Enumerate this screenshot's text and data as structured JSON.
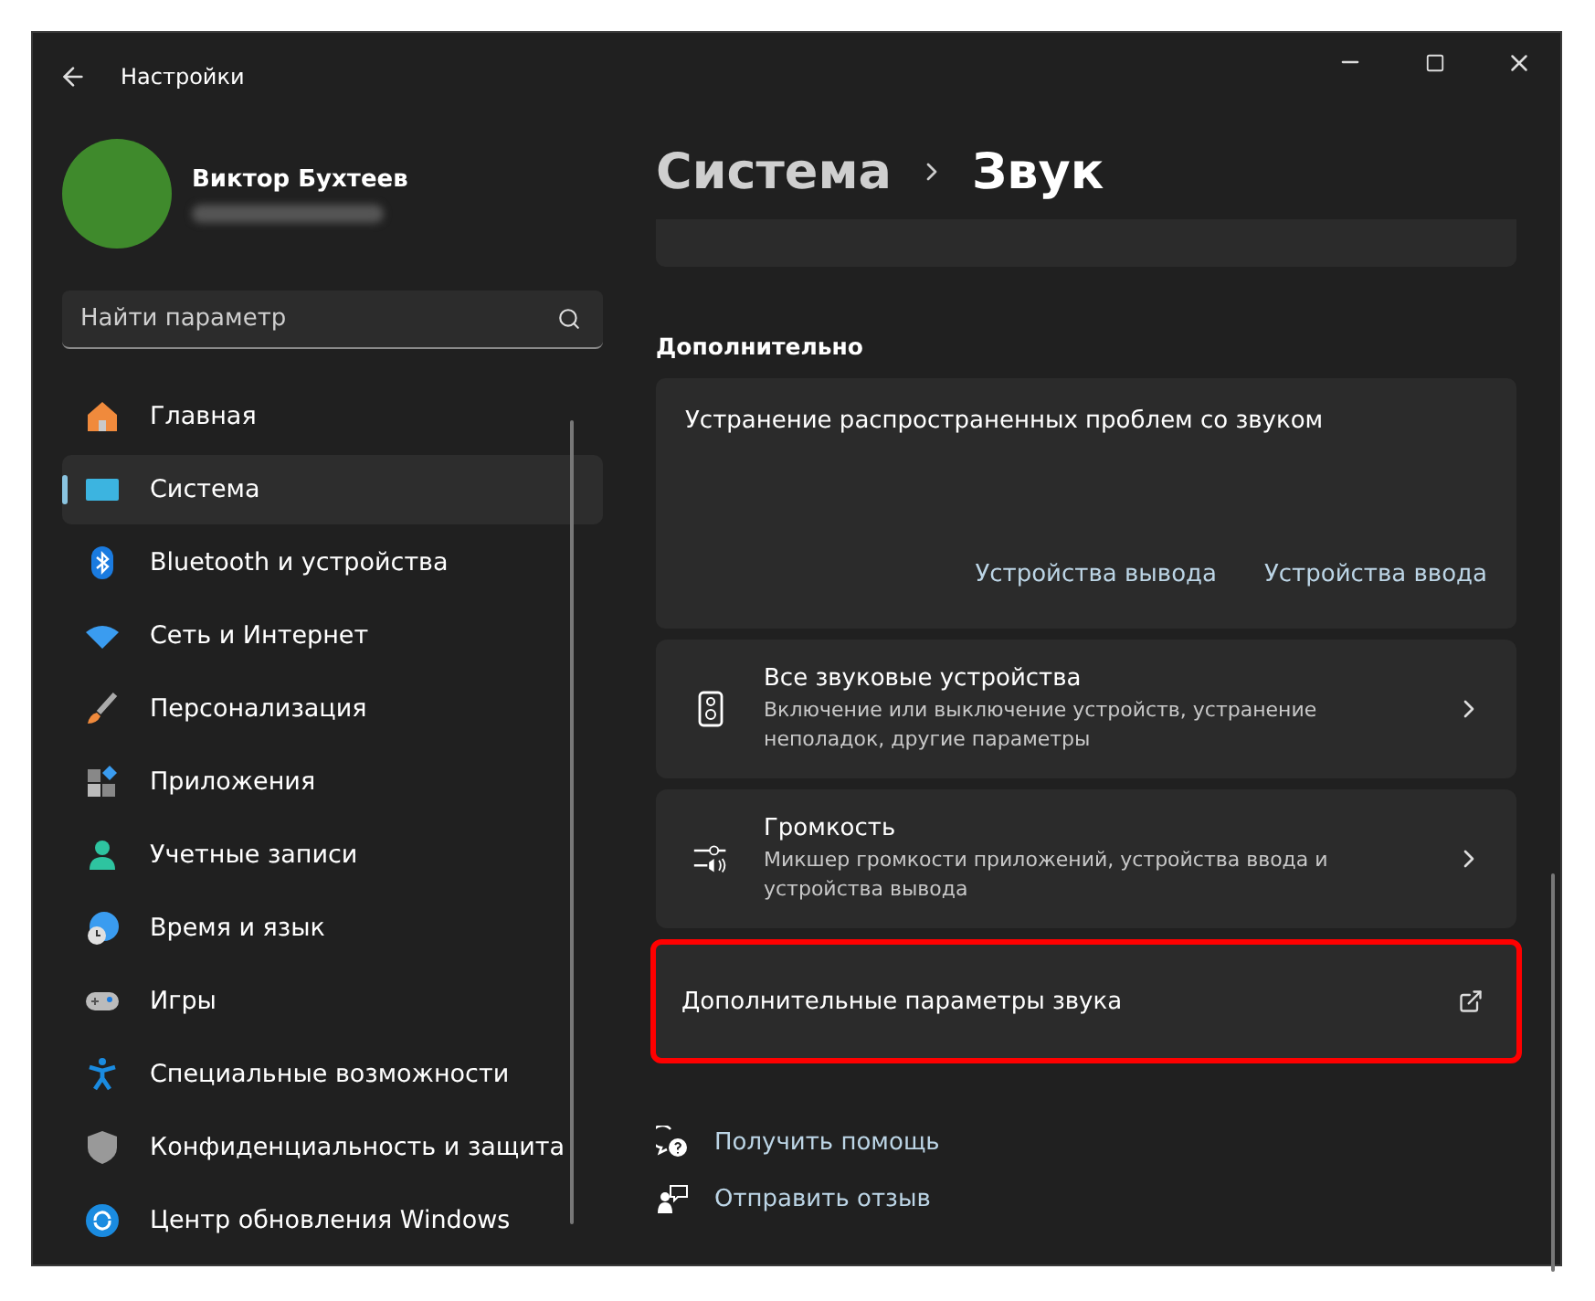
{
  "window": {
    "title": "Настройки"
  },
  "profile": {
    "name": "Виктор Бухтеев"
  },
  "search": {
    "placeholder": "Найти параметр"
  },
  "nav": [
    {
      "label": "Главная",
      "selected": false
    },
    {
      "label": "Система",
      "selected": true
    },
    {
      "label": "Bluetooth и устройства",
      "selected": false
    },
    {
      "label": "Сеть и Интернет",
      "selected": false
    },
    {
      "label": "Персонализация",
      "selected": false
    },
    {
      "label": "Приложения",
      "selected": false
    },
    {
      "label": "Учетные записи",
      "selected": false
    },
    {
      "label": "Время и язык",
      "selected": false
    },
    {
      "label": "Игры",
      "selected": false
    },
    {
      "label": "Специальные возможности",
      "selected": false
    },
    {
      "label": "Конфиденциальность и защита",
      "selected": false
    },
    {
      "label": "Центр обновления Windows",
      "selected": false
    }
  ],
  "breadcrumb": [
    "Система",
    "Звук"
  ],
  "section_title": "Дополнительно",
  "troubleshoot": {
    "title": "Устранение распространенных проблем со звуком",
    "buttons": [
      "Устройства вывода",
      "Устройства ввода"
    ]
  },
  "cards": [
    {
      "kind": "nav",
      "title": "Все звуковые устройства",
      "description": "Включение или выключение устройств, устранение неполадок, другие параметры",
      "highlighted": false
    },
    {
      "kind": "nav",
      "title": "Громкость",
      "description": "Микшер громкости приложений, устройства ввода и устройства вывода",
      "highlighted": false
    },
    {
      "kind": "external",
      "title": "Дополнительные параметры звука",
      "highlighted": true
    }
  ],
  "links": [
    "Получить помощь",
    "Отправить отзыв"
  ]
}
